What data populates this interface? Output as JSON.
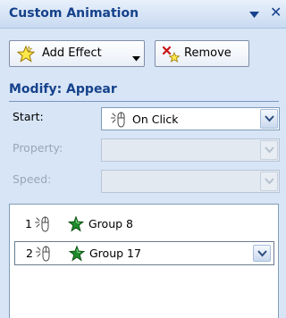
{
  "window": {
    "title": "Custom Animation"
  },
  "toolbar": {
    "add_effect_label": "Add Effect",
    "remove_label": "Remove"
  },
  "modify": {
    "header": "Modify: Appear",
    "start": {
      "label": "Start:",
      "value": "On Click",
      "enabled": true
    },
    "property": {
      "label": "Property:",
      "value": "",
      "enabled": false
    },
    "speed": {
      "label": "Speed:",
      "value": "",
      "enabled": false
    }
  },
  "animations": [
    {
      "order": "1",
      "trigger_icon": "mouse-click-icon",
      "effect_icon": "green-star-icon",
      "name": "Group 8",
      "selected": false
    },
    {
      "order": "2",
      "trigger_icon": "mouse-click-icon",
      "effect_icon": "green-star-icon",
      "name": "Group 17",
      "selected": true
    }
  ],
  "icons": {
    "add_effect": "yellow-star-icon",
    "remove": "remove-effect-icon",
    "window_menu": "triangle-down-icon",
    "window_close": "close-icon"
  },
  "colors": {
    "pane_background": "#d8e5f6",
    "header_text": "#15428b",
    "effect_star": "#1f8a2b"
  }
}
